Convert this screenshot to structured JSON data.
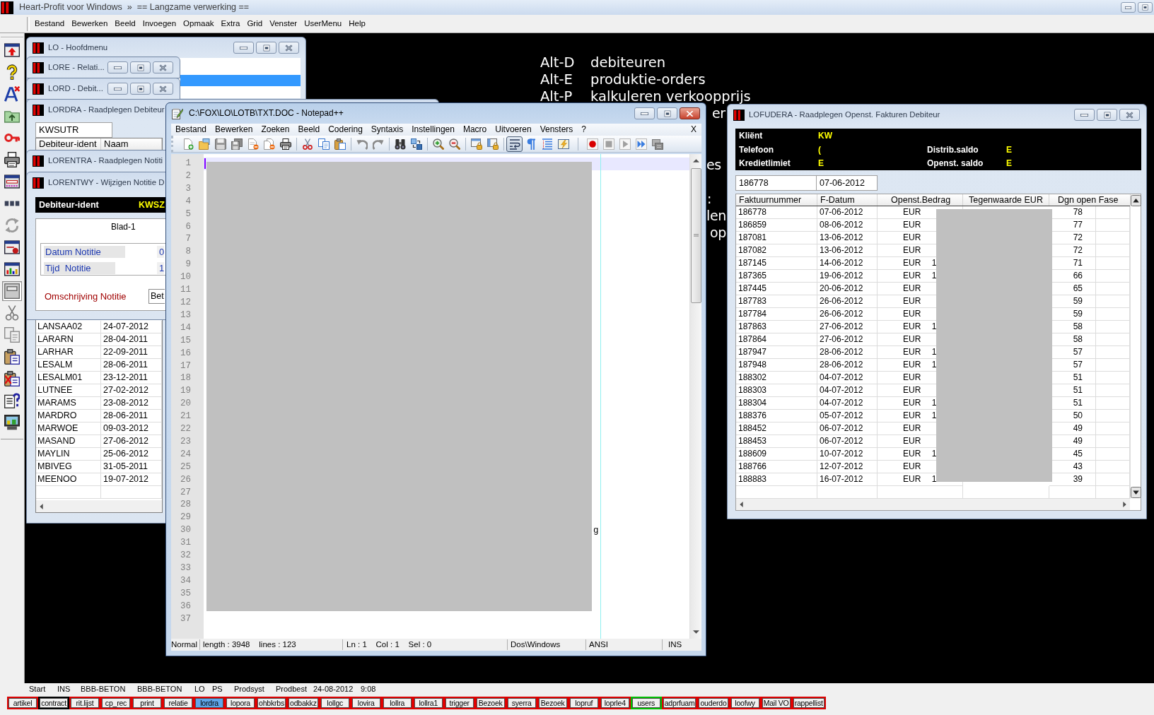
{
  "app": {
    "title": "Heart-Profit voor Windows  »  == Langzame verwerking ==",
    "menu": [
      "Bestand",
      "Bewerken",
      "Beeld",
      "Invoegen",
      "Opmaak",
      "Extra",
      "Grid",
      "Venster",
      "UserMenu",
      "Help"
    ]
  },
  "left_toolbar": [
    {
      "pressed": false
    },
    {
      "pressed": false
    },
    {
      "pressed": false
    },
    {
      "pressed": false
    },
    {
      "pressed": false
    },
    {
      "pressed": false
    },
    {
      "pressed": false
    },
    {
      "pressed": false
    },
    {
      "pressed": false
    },
    {
      "pressed": false
    },
    {
      "pressed": false
    },
    {
      "pressed": true
    },
    {
      "pressed": false
    },
    {
      "pressed": false
    },
    {
      "pressed": false
    },
    {
      "pressed": false
    },
    {
      "pressed": false
    },
    {
      "pressed": false
    }
  ],
  "background_menu": {
    "lines": [
      {
        "key": "Alt-D",
        "action": "debiteuren"
      },
      {
        "key": "Alt-E",
        "action": "produktie-orders"
      },
      {
        "key": "Alt-P",
        "action": "kalkuleren verkoopprijs"
      }
    ],
    "cut_off_lines": [
      "er",
      "es",
      ":",
      "len",
      "op"
    ]
  },
  "hoofdmenu": {
    "title": "LO - Hoofdmenu",
    "active": false,
    "rows": [
      {
        "selected": false
      },
      {
        "selected": true
      }
    ]
  },
  "minimized_windows": [
    {
      "title": "LORE - Relati...",
      "active": false
    },
    {
      "title": "LORD - Debit...",
      "active": false
    }
  ],
  "lordra": {
    "title": "LORDRA - Raadplegen Debiteur",
    "active": false,
    "search_value": "KWSUTR",
    "columns": [
      "Debiteur-ident",
      "Naam"
    ],
    "rows": [
      [
        "LANSAA02",
        "24-07-2012"
      ],
      [
        "LARARN",
        "28-04-2011"
      ],
      [
        "LARHAR",
        "22-09-2011"
      ],
      [
        "LESALM",
        "28-06-2011"
      ],
      [
        "LESALM01",
        "23-12-2011"
      ],
      [
        "LUTNEE",
        "27-02-2012"
      ],
      [
        "MARAMS",
        "23-08-2012"
      ],
      [
        "MARDRO",
        "28-06-2011"
      ],
      [
        "MARWOE",
        "09-03-2012"
      ],
      [
        "MASAND",
        "27-06-2012"
      ],
      [
        "MAYLIN",
        "25-06-2012"
      ],
      [
        "MBIVEG",
        "31-05-2011"
      ],
      [
        "MEENOO",
        "19-07-2012"
      ]
    ]
  },
  "lorentra": {
    "title": "LORENTRA - Raadplegen Notiti",
    "active": false
  },
  "lorentwy": {
    "title": "LORENTWY - Wijzigen Notitie D",
    "active": false,
    "header": {
      "label": "Debiteur-ident",
      "value": "KWSZ"
    },
    "sheet": "Blad-1",
    "fields": [
      {
        "label": "Datum Notitie",
        "value": "0"
      },
      {
        "label": "Tijd  Notitie",
        "value": "1"
      }
    ],
    "description": {
      "label": "Omschrijving Notitie",
      "value": "Bet"
    }
  },
  "notepad": {
    "title": "C:\\FOX\\LO\\LOTB\\TXT.DOC - Notepad++",
    "active": true,
    "menu": [
      "Bestand",
      "Bewerken",
      "Zoeken",
      "Beeld",
      "Codering",
      "Syntaxis",
      "Instellingen",
      "Macro",
      "Uitvoeren",
      "Vensters",
      "?"
    ],
    "close_document": "X",
    "toolbar": [
      {
        "pressed": false
      },
      {
        "pressed": false
      },
      {
        "pressed": false
      },
      {
        "pressed": false
      },
      {
        "pressed": false
      },
      {
        "pressed": false
      },
      {
        "pressed": false
      },
      {
        "pressed": false
      },
      {
        "pressed": false
      },
      {
        "pressed": false
      },
      {
        "pressed": false
      },
      {
        "pressed": false
      },
      {
        "pressed": false
      },
      {
        "pressed": false
      },
      {
        "pressed": false
      },
      {
        "pressed": false
      },
      {
        "pressed": false
      },
      {
        "pressed": false
      },
      {
        "pressed": true
      },
      {
        "pressed": false
      },
      {
        "pressed": false
      },
      {
        "pressed": false
      },
      {
        "pressed": false
      },
      {
        "pressed": false
      },
      {
        "pressed": false
      },
      {
        "pressed": false
      },
      {
        "pressed": false
      }
    ],
    "lines": [
      {
        "number": "1",
        "current": true
      },
      {
        "number": "2",
        "current": false
      },
      {
        "number": "3",
        "current": false
      },
      {
        "number": "4",
        "current": false
      },
      {
        "number": "5",
        "current": false
      },
      {
        "number": "6",
        "current": false
      },
      {
        "number": "7",
        "current": false
      },
      {
        "number": "8",
        "current": false
      },
      {
        "number": "9",
        "current": false
      },
      {
        "number": "10",
        "current": false
      },
      {
        "number": "11",
        "current": false
      },
      {
        "number": "12",
        "current": false
      },
      {
        "number": "13",
        "current": false
      },
      {
        "number": "14",
        "current": false
      },
      {
        "number": "15",
        "current": false
      },
      {
        "number": "16",
        "current": false
      },
      {
        "number": "17",
        "current": false
      },
      {
        "number": "18",
        "current": false
      },
      {
        "number": "19",
        "current": false
      },
      {
        "number": "20",
        "current": false
      },
      {
        "number": "21",
        "current": false
      },
      {
        "number": "22",
        "current": false
      },
      {
        "number": "23",
        "current": false
      },
      {
        "number": "24",
        "current": false
      },
      {
        "number": "25",
        "current": false
      },
      {
        "number": "26",
        "current": false
      },
      {
        "number": "27",
        "current": false
      },
      {
        "number": "28",
        "current": false
      },
      {
        "number": "29",
        "current": false
      },
      {
        "number": "30",
        "current": false,
        "tail": "g"
      },
      {
        "number": "31",
        "current": false
      },
      {
        "number": "32",
        "current": false
      },
      {
        "number": "33",
        "current": false
      },
      {
        "number": "34",
        "current": false
      },
      {
        "number": "35",
        "current": false
      },
      {
        "number": "36",
        "current": false
      },
      {
        "number": "37",
        "current": false
      }
    ],
    "status": [
      "Normal",
      "length : 3948    lines : 123",
      "Ln : 1    Col : 1    Sel : 0",
      "Dos\\Windows",
      "ANSI",
      "INS"
    ]
  },
  "lofudera": {
    "title": "LOFUDERA - Raadplegen Openst. Fakturen Debiteur",
    "active": false,
    "info": [
      [
        {
          "label": "Kliënt",
          "value": "KW"
        }
      ],
      [
        {
          "label": "Telefoon",
          "value": "("
        },
        {
          "label": "Distrib.saldo",
          "value": "E"
        }
      ],
      [
        {
          "label": "Kredietlimiet",
          "value": "E"
        },
        {
          "label": "Openst. saldo",
          "value": "E"
        }
      ]
    ],
    "fields": [
      "186778",
      "07-06-2012"
    ],
    "columns": [
      "Faktuurnummer",
      "F-Datum",
      "Openst.Bedrag",
      "Tegenwaarde EUR",
      "Dgn open Fase"
    ],
    "rows": [
      {
        "number": "186778",
        "date": "07-06-2012",
        "amount": "EUR",
        "days": "78"
      },
      {
        "number": "186859",
        "date": "08-06-2012",
        "amount": "EUR",
        "days": "77"
      },
      {
        "number": "187081",
        "date": "13-06-2012",
        "amount": "EUR",
        "days": "72"
      },
      {
        "number": "187082",
        "date": "13-06-2012",
        "amount": "EUR",
        "days": "72"
      },
      {
        "number": "187145",
        "date": "14-06-2012",
        "amount": "EUR 1",
        "days": "71"
      },
      {
        "number": "187365",
        "date": "19-06-2012",
        "amount": "EUR 1",
        "days": "66"
      },
      {
        "number": "187445",
        "date": "20-06-2012",
        "amount": "EUR",
        "days": "65"
      },
      {
        "number": "187783",
        "date": "26-06-2012",
        "amount": "EUR",
        "days": "59"
      },
      {
        "number": "187784",
        "date": "26-06-2012",
        "amount": "EUR",
        "days": "59"
      },
      {
        "number": "187863",
        "date": "27-06-2012",
        "amount": "EUR 1",
        "days": "58"
      },
      {
        "number": "187864",
        "date": "27-06-2012",
        "amount": "EUR",
        "days": "58"
      },
      {
        "number": "187947",
        "date": "28-06-2012",
        "amount": "EUR 1",
        "days": "57"
      },
      {
        "number": "187948",
        "date": "28-06-2012",
        "amount": "EUR 1",
        "days": "57"
      },
      {
        "number": "188302",
        "date": "04-07-2012",
        "amount": "EUR",
        "days": "51"
      },
      {
        "number": "188303",
        "date": "04-07-2012",
        "amount": "EUR",
        "days": "51"
      },
      {
        "number": "188304",
        "date": "04-07-2012",
        "amount": "EUR 1",
        "days": "51"
      },
      {
        "number": "188376",
        "date": "05-07-2012",
        "amount": "EUR 1",
        "days": "50"
      },
      {
        "number": "188452",
        "date": "06-07-2012",
        "amount": "EUR",
        "days": "49"
      },
      {
        "number": "188453",
        "date": "06-07-2012",
        "amount": "EUR",
        "days": "49"
      },
      {
        "number": "188609",
        "date": "10-07-2012",
        "amount": "EUR 1",
        "days": "45"
      },
      {
        "number": "188766",
        "date": "12-07-2012",
        "amount": "EUR",
        "days": "43"
      },
      {
        "number": "188883",
        "date": "16-07-2012",
        "amount": "EUR 1",
        "days": "39"
      }
    ]
  },
  "status_bar": [
    "Start",
    "INS",
    "BBB-BETON",
    "BBB-BETON",
    "LO",
    "PS",
    "Prodsyst",
    "Prodbest",
    "24-08-2012",
    "9:08"
  ],
  "taskbar": [
    {
      "label": "artikel",
      "color": "#e00000",
      "selected": false
    },
    {
      "label": "contract",
      "color": "#000000",
      "selected": false
    },
    {
      "label": "rit.lijst",
      "color": "#e00000",
      "selected": false
    },
    {
      "label": "cp_rec",
      "color": "#e00000",
      "selected": false
    },
    {
      "label": "print",
      "color": "#e00000",
      "selected": false
    },
    {
      "label": "relatie",
      "color": "#e00000",
      "selected": false
    },
    {
      "label": "lordra",
      "color": "#e00000",
      "selected": true
    },
    {
      "label": "lopora",
      "color": "#e00000",
      "selected": false
    },
    {
      "label": "ohbkrbs",
      "color": "#e00000",
      "selected": false
    },
    {
      "label": "odbakkz",
      "color": "#e00000",
      "selected": false
    },
    {
      "label": "lollgc",
      "color": "#e00000",
      "selected": false
    },
    {
      "label": "lovira",
      "color": "#e00000",
      "selected": false
    },
    {
      "label": "lollra",
      "color": "#e00000",
      "selected": false
    },
    {
      "label": "lollra1",
      "color": "#e00000",
      "selected": false
    },
    {
      "label": "trigger",
      "color": "#e00000",
      "selected": false
    },
    {
      "label": "Bezoek",
      "color": "#e00000",
      "selected": false
    },
    {
      "label": "syerra",
      "color": "#e00000",
      "selected": false
    },
    {
      "label": "Bezoek",
      "color": "#e00000",
      "selected": false
    },
    {
      "label": "lopruf",
      "color": "#e00000",
      "selected": false
    },
    {
      "label": "loprle4",
      "color": "#e00000",
      "selected": false
    },
    {
      "label": "users",
      "color": "#00c000",
      "selected": false
    },
    {
      "label": "adprfuam",
      "color": "#e00000",
      "selected": false
    },
    {
      "label": "ouderdo",
      "color": "#e00000",
      "selected": false
    },
    {
      "label": "loofwy",
      "color": "#e00000",
      "selected": false
    },
    {
      "label": "Mail VO",
      "color": "#e00000",
      "selected": false
    },
    {
      "label": "rappellist",
      "color": "#e00000",
      "selected": false
    }
  ]
}
